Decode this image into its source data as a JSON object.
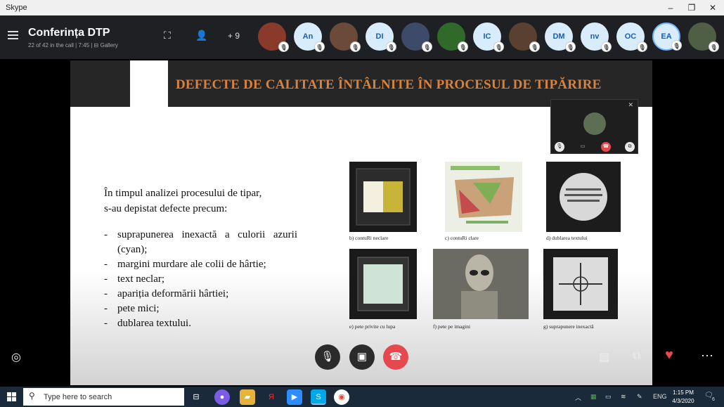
{
  "window": {
    "title": "Skype",
    "minimize": "–",
    "restore": "❐",
    "close": "✕"
  },
  "call": {
    "title": "Conferința DTP",
    "status": "22 of 42 in the call | 7:45  |  ⊟ Gallery",
    "add_count": "+ 9"
  },
  "participants": [
    {
      "initials": "",
      "icon": "photo-avatar",
      "color": "#8a3a2a"
    },
    {
      "initials": "An",
      "icon": "initials-avatar"
    },
    {
      "initials": "",
      "icon": "photo-avatar",
      "color": "#6b4a3a"
    },
    {
      "initials": "DI",
      "icon": "initials-avatar"
    },
    {
      "initials": "",
      "icon": "photo-avatar",
      "color": "#3e4a6a"
    },
    {
      "initials": "",
      "icon": "photo-avatar",
      "color": "#2f6a2a"
    },
    {
      "initials": "IC",
      "icon": "initials-avatar"
    },
    {
      "initials": "",
      "icon": "photo-avatar",
      "color": "#5a4030"
    },
    {
      "initials": "DM",
      "icon": "initials-avatar"
    },
    {
      "initials": "nv",
      "icon": "initials-avatar"
    },
    {
      "initials": "OC",
      "icon": "initials-avatar"
    },
    {
      "initials": "EA",
      "icon": "initials-avatar",
      "selected": true
    },
    {
      "initials": "",
      "icon": "photo-avatar",
      "color": "#4f5f46"
    }
  ],
  "slide": {
    "title": "DEFECTE DE CALITATE ÎNTÂLNITE ÎN PROCESUL DE TIPĂRIRE",
    "intro_line1": "În timpul analizei procesului de tipar,",
    "intro_line2": "s-au depistat defecte precum:",
    "defects": [
      "suprapunerea inexactă a culorii azurii (cyan);",
      "margini murdare ale colii de hârtie;",
      "text neclar;",
      "apariția deformării hârtiei;",
      "pete mici;",
      "dublarea textului."
    ],
    "figures": [
      {
        "caption": "b)  contuRi neclare"
      },
      {
        "caption": "c)  contuRi clare"
      },
      {
        "caption": "d)  dublarea textului"
      },
      {
        "caption": "e)  pete privite cu lupa"
      },
      {
        "caption": "f)  pete pe imagini"
      },
      {
        "caption": "g)  suprapunere inexactă"
      }
    ]
  },
  "taskbar": {
    "search_placeholder": "Type here to search",
    "language": "ENG",
    "time": "1:15 PM",
    "date": "4/3/2020",
    "notification_count": "6"
  },
  "colors": {
    "end_call": "#e5484d",
    "header": "#1f2024",
    "slide_title": "#d9823b",
    "heart": "#e5484d"
  }
}
